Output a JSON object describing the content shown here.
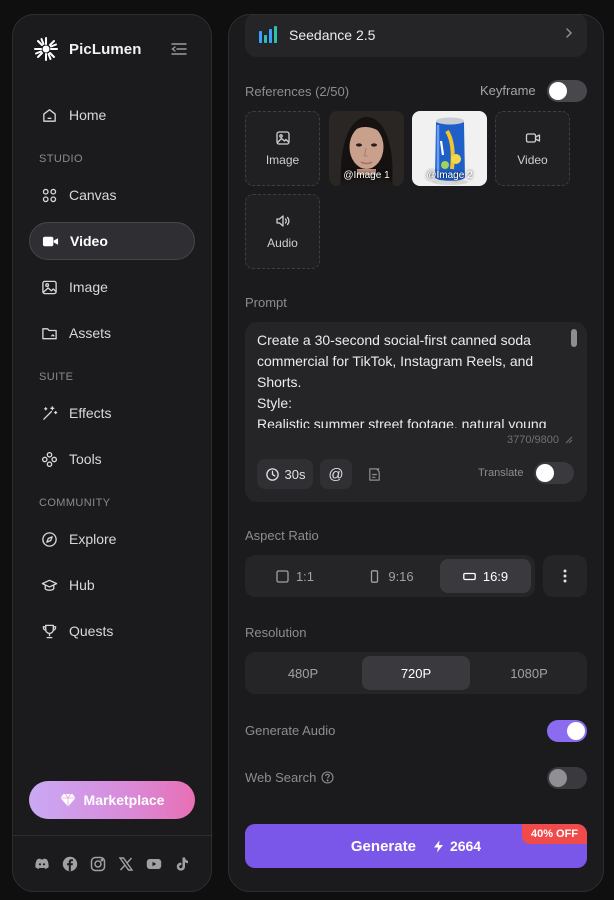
{
  "brand": {
    "name": "PicLumen"
  },
  "sidebar": {
    "home": "Home",
    "studio_header": "STUDIO",
    "canvas": "Canvas",
    "video": "Video",
    "image": "Image",
    "assets": "Assets",
    "suite_header": "SUITE",
    "effects": "Effects",
    "tools": "Tools",
    "community_header": "COMMUNITY",
    "explore": "Explore",
    "hub": "Hub",
    "quests": "Quests",
    "marketplace": "Marketplace",
    "socials": [
      "discord-icon",
      "facebook-icon",
      "instagram-icon",
      "x-icon",
      "youtube-icon",
      "tiktok-icon"
    ]
  },
  "panel": {
    "model": "Seedance 2.5",
    "references_label": "References (2/50)",
    "keyframe_label": "Keyframe",
    "keyframe_on": false,
    "ref_tiles": {
      "image": "Image",
      "video": "Video",
      "audio": "Audio",
      "image1_tag": "@Image 1",
      "image2_tag": "@Image 2"
    },
    "prompt_label": "Prompt",
    "prompt_text": "Create a 30-second social-first canned soda commercial for TikTok, Instagram Reels, and Shorts.\nStyle:\nRealistic summer street footage, natural young",
    "char_count": "3770/9800",
    "duration": "30s",
    "mention": "@",
    "translate_label": "Translate",
    "translate_on": false,
    "aspect_label": "Aspect Ratio",
    "aspect_options": [
      "1:1",
      "9:16",
      "16:9"
    ],
    "aspect_selected": "16:9",
    "resolution_label": "Resolution",
    "resolution_options": [
      "480P",
      "720P",
      "1080P"
    ],
    "resolution_selected": "720P",
    "generate_audio_label": "Generate Audio",
    "generate_audio_on": true,
    "web_search_label": "Web Search",
    "web_search_on": false,
    "generate_label": "Generate",
    "credits": "2664",
    "discount_badge": "40% OFF"
  },
  "colors": {
    "accent": "#7a57e8",
    "toggle_on": "#8b6cf0",
    "badge": "#f04a4a"
  }
}
